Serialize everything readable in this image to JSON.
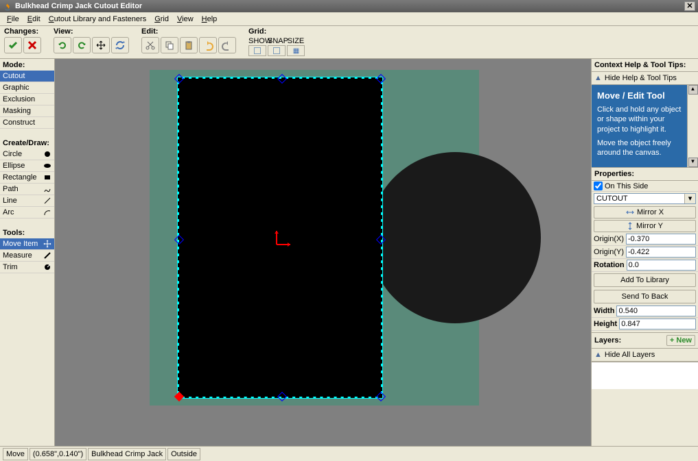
{
  "title": "Bulkhead Crimp Jack Cutout Editor",
  "menubar": [
    "File",
    "Edit",
    "Cutout Library and Fasteners",
    "Grid",
    "View",
    "Help"
  ],
  "toolbar": {
    "changes": {
      "label": "Changes:"
    },
    "view": {
      "label": "View:"
    },
    "edit": {
      "label": "Edit:"
    },
    "grid": {
      "label": "Grid:",
      "cols": [
        "SHOW",
        "SNAP",
        "SIZE"
      ]
    }
  },
  "left": {
    "mode": {
      "header": "Mode:",
      "items": [
        "Cutout",
        "Graphic",
        "Exclusion",
        "Masking",
        "Construct"
      ],
      "selected": 0
    },
    "create": {
      "header": "Create/Draw:",
      "items": [
        "Circle",
        "Ellipse",
        "Rectangle",
        "Path",
        "Line",
        "Arc"
      ]
    },
    "tools": {
      "header": "Tools:",
      "items": [
        "Move Item",
        "Measure",
        "Trim"
      ],
      "selected": 0
    }
  },
  "right": {
    "help_header": "Context Help & Tool Tips:",
    "hide_help": "Hide Help & Tool Tips",
    "help_title": "Move / Edit Tool",
    "help_p1": "Click and hold any object or shape within your project to highlight it.",
    "help_p2": "Move the object freely around the canvas.",
    "props_header": "Properties:",
    "on_this_side": "On This Side",
    "type": "CUTOUT",
    "mirror_x": "Mirror X",
    "mirror_y": "Mirror Y",
    "origin_x_label": "Origin(X)",
    "origin_x": "-0.370",
    "origin_y_label": "Origin(Y)",
    "origin_y": "-0.422",
    "rotation_label": "Rotation",
    "rotation": "0.0",
    "add_library": "Add To Library",
    "send_back": "Send To Back",
    "width_label": "Width",
    "width": "0.540",
    "height_label": "Height",
    "height": "0.847",
    "layers_header": "Layers:",
    "new": "+ New",
    "hide_layers": "Hide All Layers"
  },
  "status": {
    "mode": "Move",
    "coords": "(0.658\",0.140\")",
    "name": "Bulkhead Crimp Jack",
    "side": "Outside"
  }
}
